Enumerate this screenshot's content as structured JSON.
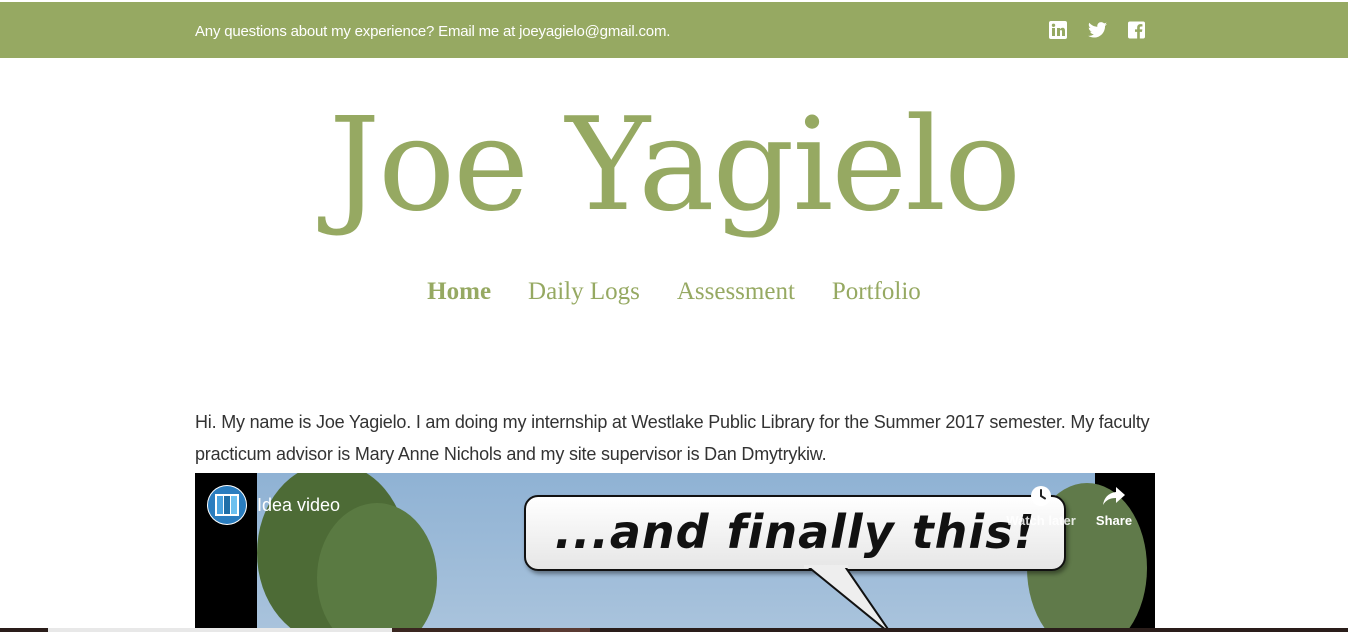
{
  "topbar": {
    "contact_text": "Any questions about my experience? Email me at joeyagielo@gmail.com.",
    "social": [
      {
        "icon": "linkedin-icon"
      },
      {
        "icon": "twitter-icon"
      },
      {
        "icon": "facebook-icon"
      }
    ]
  },
  "site": {
    "title": "Joe Yagielo"
  },
  "nav": {
    "items": [
      {
        "label": "Home",
        "active": true
      },
      {
        "label": "Daily Logs",
        "active": false
      },
      {
        "label": "Assessment",
        "active": false
      },
      {
        "label": "Portfolio",
        "active": false
      }
    ]
  },
  "intro": {
    "text": "Hi. My name is Joe Yagielo. I am doing my internship at Westlake Public Library for the Summer 2017 semester. My faculty practicum advisor is Mary Anne Nichols and my site supervisor is Dan Dmytrykiw."
  },
  "video": {
    "title": "Idea video",
    "caption": "...and finally this!",
    "watch_later_label": "Watch later",
    "share_label": "Share"
  },
  "colors": {
    "accent": "#96a962",
    "text": "#333333",
    "background": "#ffffff"
  }
}
